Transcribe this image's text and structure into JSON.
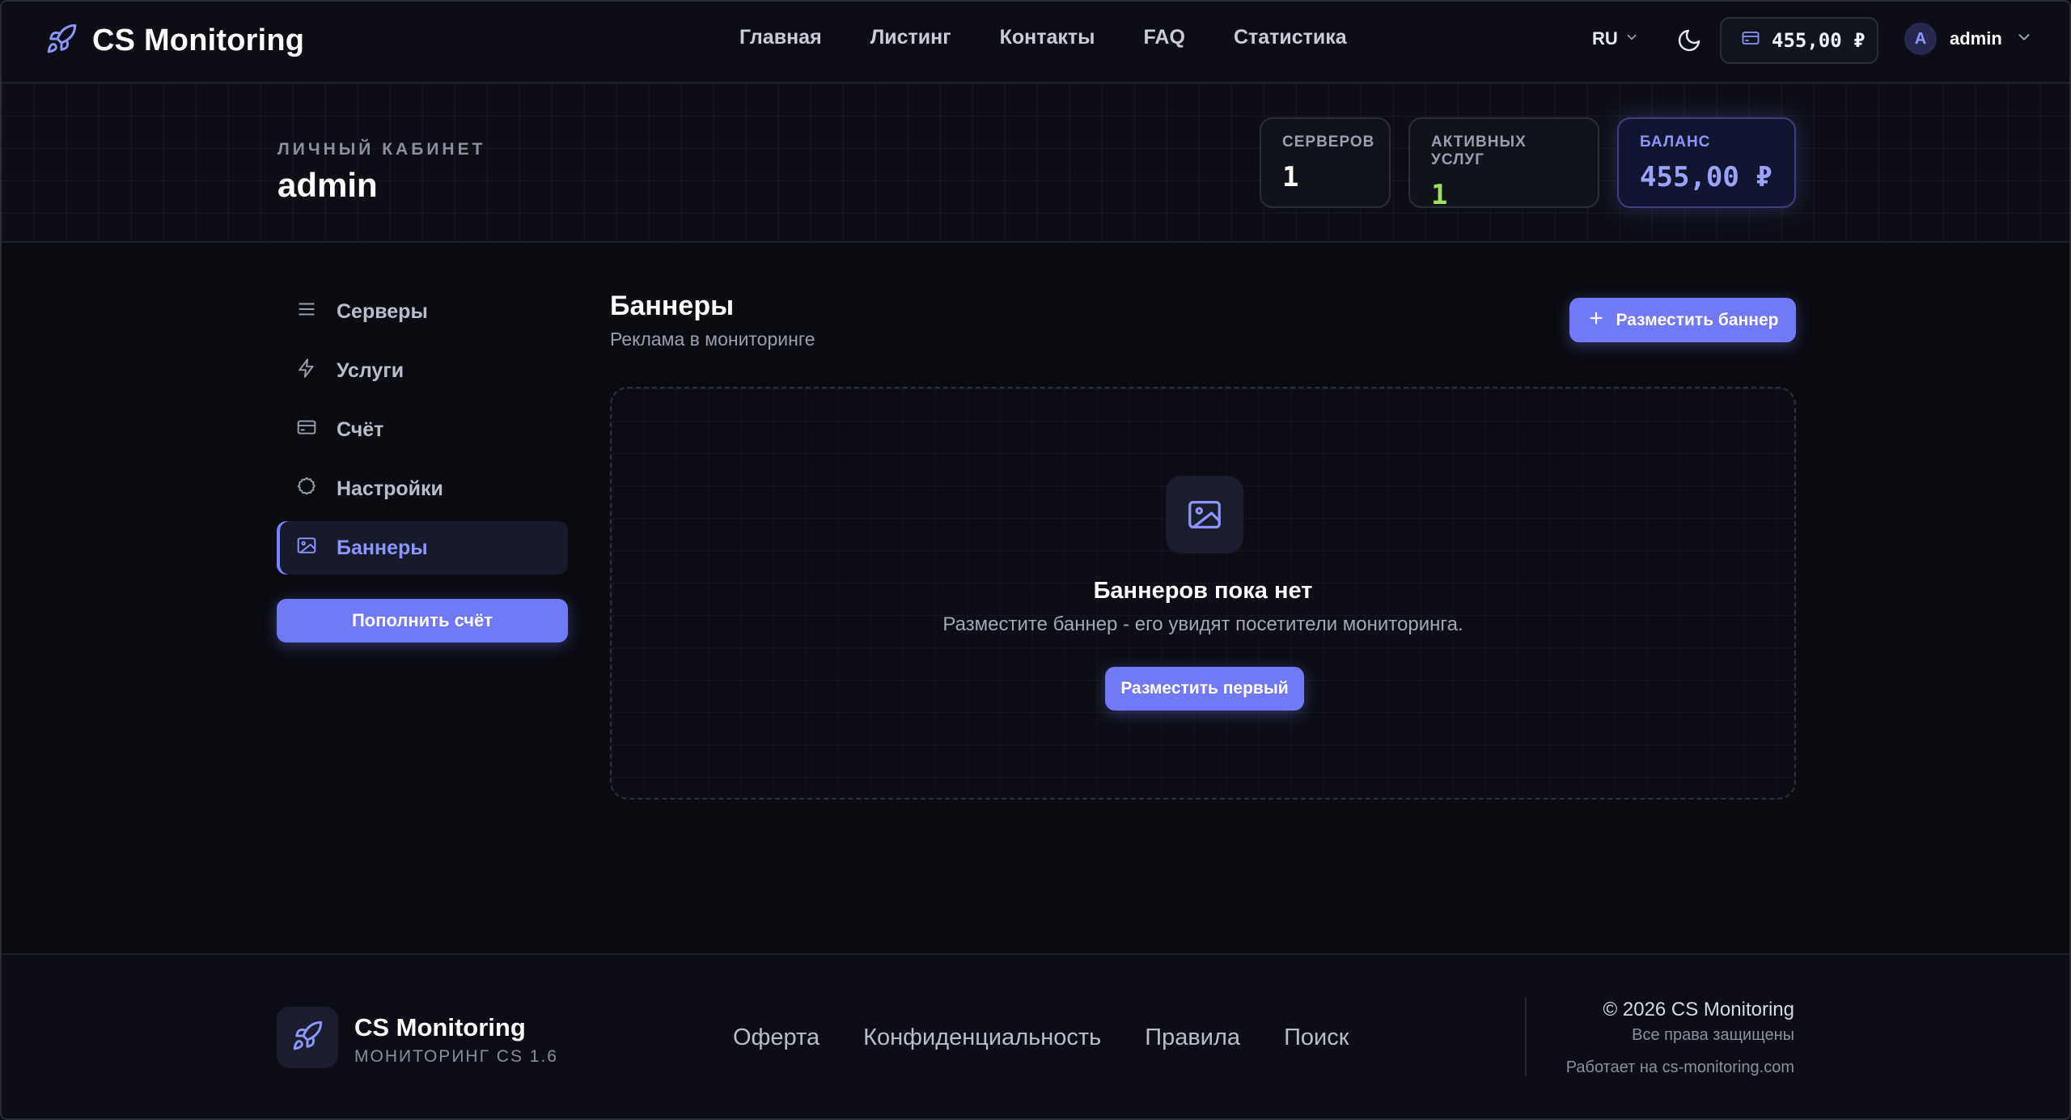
{
  "header": {
    "brand": "CS Monitoring",
    "nav": [
      "Главная",
      "Листинг",
      "Контакты",
      "FAQ",
      "Статистика"
    ],
    "lang": "RU",
    "wallet_balance": "455,00 ₽",
    "avatar_letter": "A",
    "username": "admin"
  },
  "hero": {
    "kicker": "ЛИЧНЫЙ КАБИНЕТ",
    "name": "admin",
    "stats": {
      "servers_label": "СЕРВЕРОВ",
      "servers_value": "1",
      "services_label": "АКТИВНЫХ УСЛУГ",
      "services_value": "1",
      "balance_label": "БАЛАНС",
      "balance_value": "455,00 ₽"
    }
  },
  "sidebar": {
    "items": [
      {
        "label": "Серверы",
        "icon": "list-icon"
      },
      {
        "label": "Услуги",
        "icon": "bolt-icon"
      },
      {
        "label": "Счёт",
        "icon": "card-icon"
      },
      {
        "label": "Настройки",
        "icon": "gear-icon"
      },
      {
        "label": "Баннеры",
        "icon": "image-icon",
        "active": true
      }
    ],
    "topup_label": "Пополнить счёт"
  },
  "main": {
    "title": "Баннеры",
    "subtitle": "Реклама в мониторинге",
    "place_button": "Разместить баннер",
    "empty": {
      "title": "Баннеров пока нет",
      "text": "Разместите баннер - его увидят посетители мониторинга.",
      "button": "Разместить первый"
    }
  },
  "footer": {
    "name": "CS Monitoring",
    "tagline": "МОНИТОРИНГ CS 1.6",
    "links": [
      "Оферта",
      "Конфиденциальность",
      "Правила",
      "Поиск"
    ],
    "copyright": "© 2026 CS Monitoring",
    "rights": "Все права защищены",
    "powered": "Работает на cs-monitoring.com"
  },
  "colors": {
    "accent": "#7179f6",
    "accent_text": "#8c94ff",
    "success": "#9be15d",
    "background": "#0b0c12"
  }
}
